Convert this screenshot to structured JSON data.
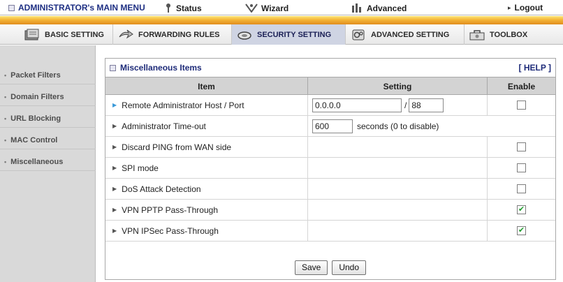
{
  "topbar": {
    "admin_label": "ADMINISTRATOR's MAIN MENU",
    "status_label": "Status",
    "wizard_label": "Wizard",
    "advanced_label": "Advanced",
    "logout_label": "Logout"
  },
  "tabs": [
    {
      "label": "BASIC SETTING",
      "icon": "folder-icon"
    },
    {
      "label": "FORWARDING RULES",
      "icon": "forward-arrow-icon"
    },
    {
      "label": "SECURITY SETTING",
      "icon": "lock-icon",
      "active": true
    },
    {
      "label": "ADVANCED SETTING",
      "icon": "gears-icon"
    },
    {
      "label": "TOOLBOX",
      "icon": "toolbox-icon"
    }
  ],
  "sidebar": {
    "items": [
      {
        "label": "Packet Filters"
      },
      {
        "label": "Domain Filters"
      },
      {
        "label": "URL Blocking"
      },
      {
        "label": "MAC Control"
      },
      {
        "label": "Miscellaneous"
      }
    ]
  },
  "panel": {
    "title": "Miscellaneous Items",
    "help": "[ HELP ]",
    "columns": {
      "item": "Item",
      "setting": "Setting",
      "enable": "Enable"
    },
    "rows": {
      "remote": {
        "label": "Remote Administrator Host / Port",
        "host": "0.0.0.0",
        "separator": "/",
        "port": "88",
        "enabled": false
      },
      "timeout": {
        "label": "Administrator Time-out",
        "value": "600",
        "suffix": "seconds (0 to disable)"
      },
      "ping": {
        "label": "Discard PING from WAN side",
        "enabled": false
      },
      "spi": {
        "label": "SPI mode",
        "enabled": false
      },
      "dos": {
        "label": "DoS Attack Detection",
        "enabled": false
      },
      "pptp": {
        "label": "VPN PPTP Pass-Through",
        "enabled": true
      },
      "ipsec": {
        "label": "VPN IPSec Pass-Through",
        "enabled": true
      }
    },
    "buttons": {
      "save": "Save",
      "undo": "Undo"
    }
  },
  "colors": {
    "accent_navy": "#1e2b79",
    "stripe_orange": "#f4b537",
    "sidebar_bg": "#d9d9d9",
    "check_green": "#219c2f"
  },
  "check_mark": "✔"
}
